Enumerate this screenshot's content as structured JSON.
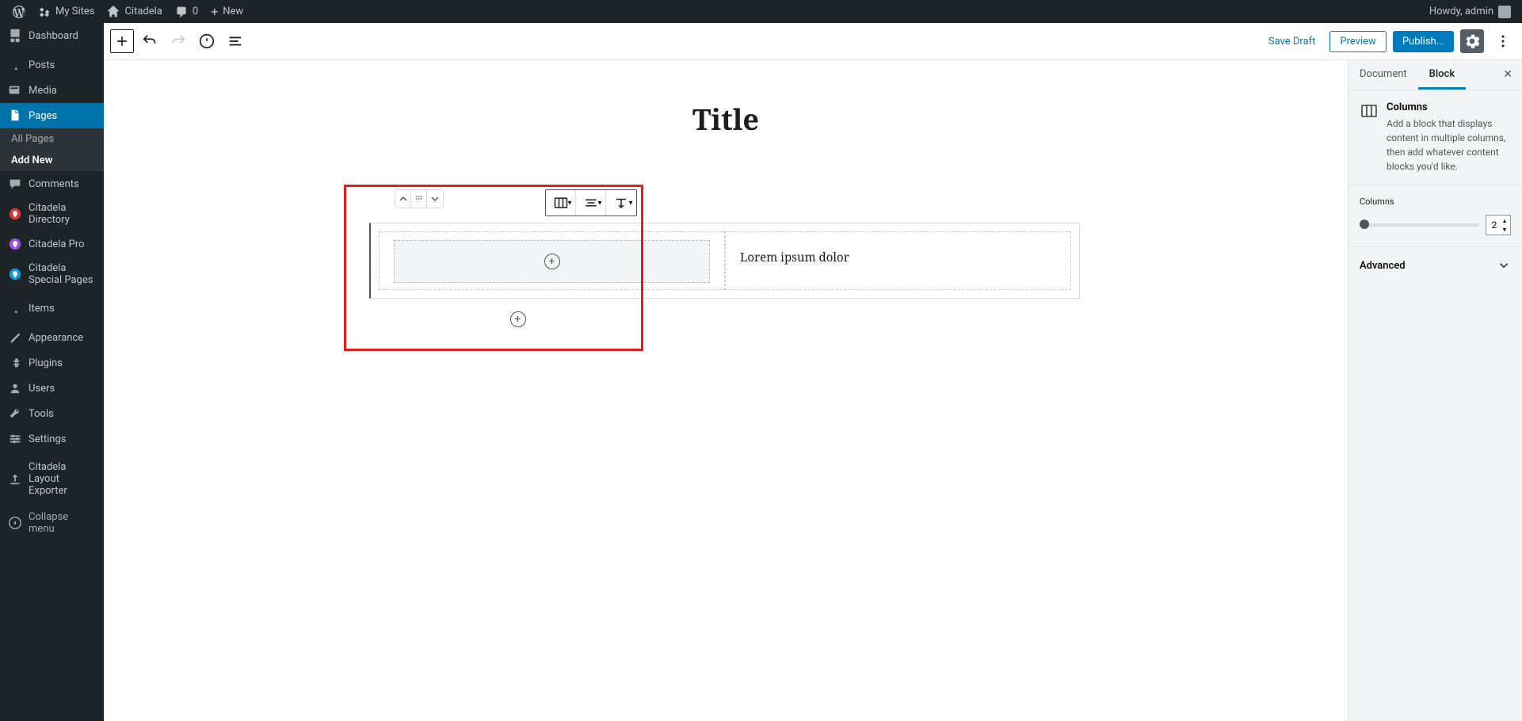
{
  "adminBar": {
    "mySites": "My Sites",
    "siteName": "Citadela",
    "commentCount": "0",
    "newLabel": "New",
    "howdy": "Howdy, admin"
  },
  "sidebar": {
    "dashboard": "Dashboard",
    "posts": "Posts",
    "media": "Media",
    "pages": "Pages",
    "allPages": "All Pages",
    "addNew": "Add New",
    "comments": "Comments",
    "citadelaDirectory": "Citadela Directory",
    "citadelaPro": "Citadela Pro",
    "citadelaSpecialPages": "Citadela Special Pages",
    "items": "Items",
    "appearance": "Appearance",
    "plugins": "Plugins",
    "users": "Users",
    "tools": "Tools",
    "settings": "Settings",
    "citadelaLayoutExporter": "Citadela Layout Exporter",
    "collapse": "Collapse menu"
  },
  "editorTopbar": {
    "saveDraft": "Save Draft",
    "preview": "Preview",
    "publish": "Publish..."
  },
  "page": {
    "title": "Title",
    "columnText": "Lorem ipsum dolor"
  },
  "rightSidebar": {
    "tabDocument": "Document",
    "tabBlock": "Block",
    "blockTitle": "Columns",
    "blockDesc": "Add a block that displays content in multiple columns, then add whatever content blocks you'd like.",
    "columnsLabel": "Columns",
    "columnsValue": "2",
    "advanced": "Advanced"
  }
}
